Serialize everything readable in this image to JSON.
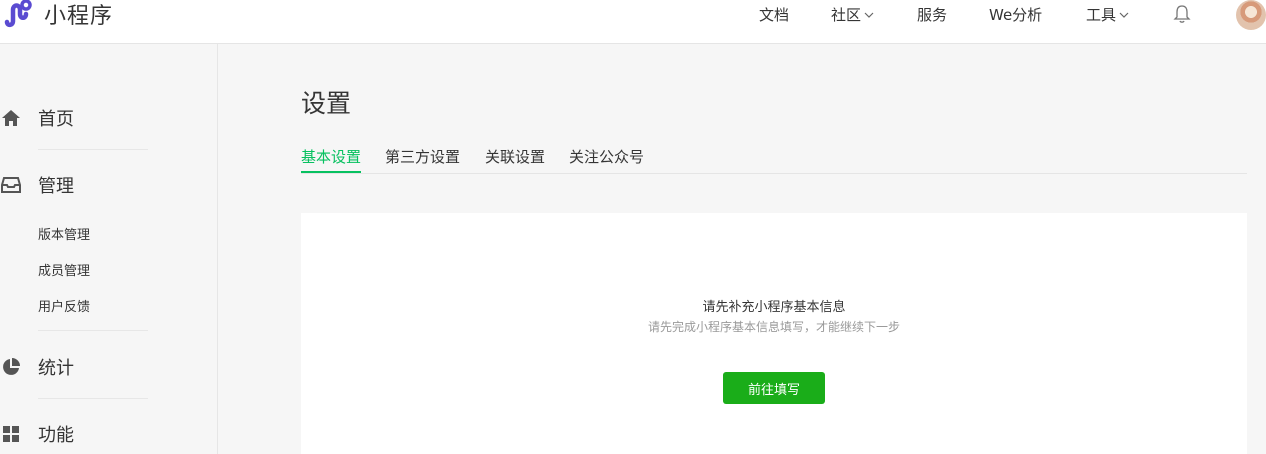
{
  "header": {
    "logo_text": "小程序",
    "nav": [
      {
        "label": "文档"
      },
      {
        "label": "社区"
      },
      {
        "label": "服务"
      },
      {
        "label": "We分析"
      },
      {
        "label": "工具"
      }
    ],
    "icons": {
      "logo": "mini-program-logo-icon",
      "bell": "bell-icon",
      "avatar": "user-avatar"
    }
  },
  "sidebar": {
    "home": "首页",
    "manage": "管理",
    "manage_items": [
      "版本管理",
      "成员管理",
      "用户反馈"
    ],
    "stats": "统计",
    "features": "功能"
  },
  "main": {
    "title": "设置",
    "tabs": [
      "基本设置",
      "第三方设置",
      "关联设置",
      "关注公众号"
    ],
    "active_tab": "基本设置",
    "notice_title": "请先补充小程序基本信息",
    "notice_sub": "请先完成小程序基本信息填写，才能继续下一步",
    "button": "前往填写"
  },
  "colors": {
    "accent": "#07c160",
    "button": "#1aad19",
    "logo": "#5a4bd1"
  }
}
